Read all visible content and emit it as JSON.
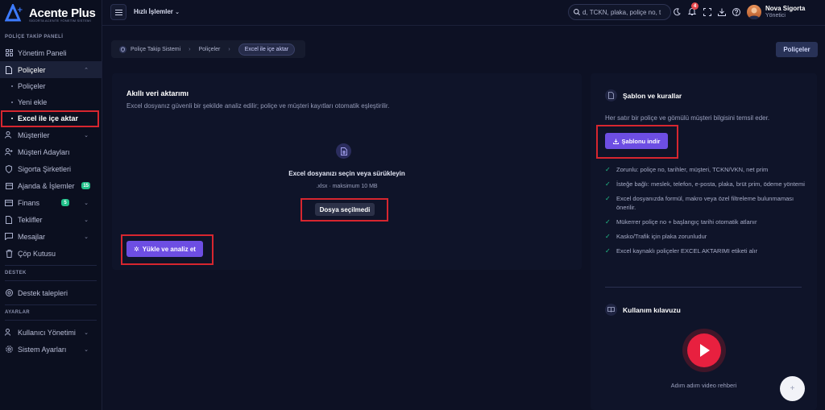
{
  "brand": {
    "name": "Acente",
    "suffix": "Plus",
    "tagline": "SİGORTA ACENTE YÖNETİM SİSTEMİ"
  },
  "sidebar": {
    "section_policy": "POLİÇE TAKİP PANELİ",
    "section_support": "DESTEK",
    "section_settings": "AYARLAR",
    "items": {
      "dashboard": "Yönetim Paneli",
      "policies": "Poliçeler",
      "policies_list": "Poliçeler",
      "policies_new": "Yeni ekle",
      "policies_excel": "Excel ile içe aktar",
      "customers": "Müşteriler",
      "leads": "Müşteri Adayları",
      "companies": "Sigorta Şirketleri",
      "agenda": "Ajanda & İşlemler",
      "agenda_badge": "15",
      "finance": "Finans",
      "finance_badge": "5",
      "offers": "Teklifler",
      "messages": "Mesajlar",
      "trash": "Çöp Kutusu",
      "tickets": "Destek talepleri",
      "user_mgmt": "Kullanıcı Yönetimi",
      "system_settings": "Sistem Ayarları"
    }
  },
  "topbar": {
    "quick_actions": "Hızlı İşlemler",
    "search_placeholder": "d, TCKN, plaka, poliçe no, t",
    "notification_count": "4",
    "user_name": "Nova Sigorta",
    "user_role": "Yönetici"
  },
  "breadcrumb": {
    "root": "Poliçe Takip Sistemi",
    "parent": "Poliçeler",
    "current": "Excel ile içe aktar"
  },
  "policies_button": "Poliçeler",
  "import_card": {
    "title": "Akıllı veri aktarımı",
    "description": "Excel dosyanız güvenli bir şekilde analiz edilir; poliçe ve müşteri kayıtları otomatik eşleştirilir.",
    "drop_title": "Excel dosyanızı seçin veya sürükleyin",
    "drop_sub": ".xlsx · maksimum 10 MB",
    "file_button": "Dosya seçilmedi",
    "upload_button": "Yükle ve analiz et"
  },
  "template_card": {
    "title": "Şablon ve kurallar",
    "description": "Her satır bir poliçe ve gömülü müşteri bilgisini temsil eder.",
    "download_button": "Şablonu indir",
    "rules": [
      "Zorunlu: poliçe no, tarihler, müşteri, TCKN/VKN, net prim",
      "İsteğe bağlı: meslek, telefon, e-posta, plaka, brüt prim, ödeme yöntemi",
      "Excel dosyanızda formül, makro veya özel filtreleme bulunmaması önerilir.",
      "Mükerrer poliçe no + başlangıç tarihi otomatik atlanır",
      "Kasko/Trafik için plaka zorunludur",
      "Excel kaynaklı poliçeler EXCEL AKTARIMI etiketi alır"
    ],
    "guide_title": "Kullanım kılavuzu",
    "video_label": "Adım adım video rehberi"
  },
  "colors": {
    "accent": "#6d4ee3",
    "success": "#22c08a",
    "danger": "#e8203f",
    "highlight": "#d7262f"
  }
}
